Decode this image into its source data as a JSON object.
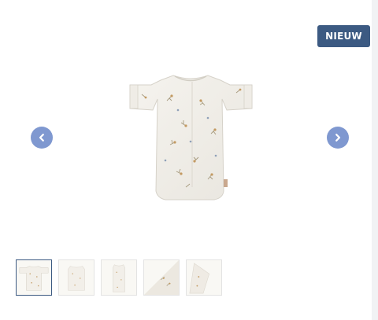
{
  "badge": {
    "label": "NIEUW",
    "color": "#3c5a82"
  },
  "carousel": {
    "prev_icon": "chevron-left-icon",
    "next_icon": "chevron-right-icon",
    "button_color": "#7f98d0",
    "main_image": "sleeping-bag-with-sleeves-floral-print",
    "active_index": 1,
    "thumbnail_count": 5
  }
}
